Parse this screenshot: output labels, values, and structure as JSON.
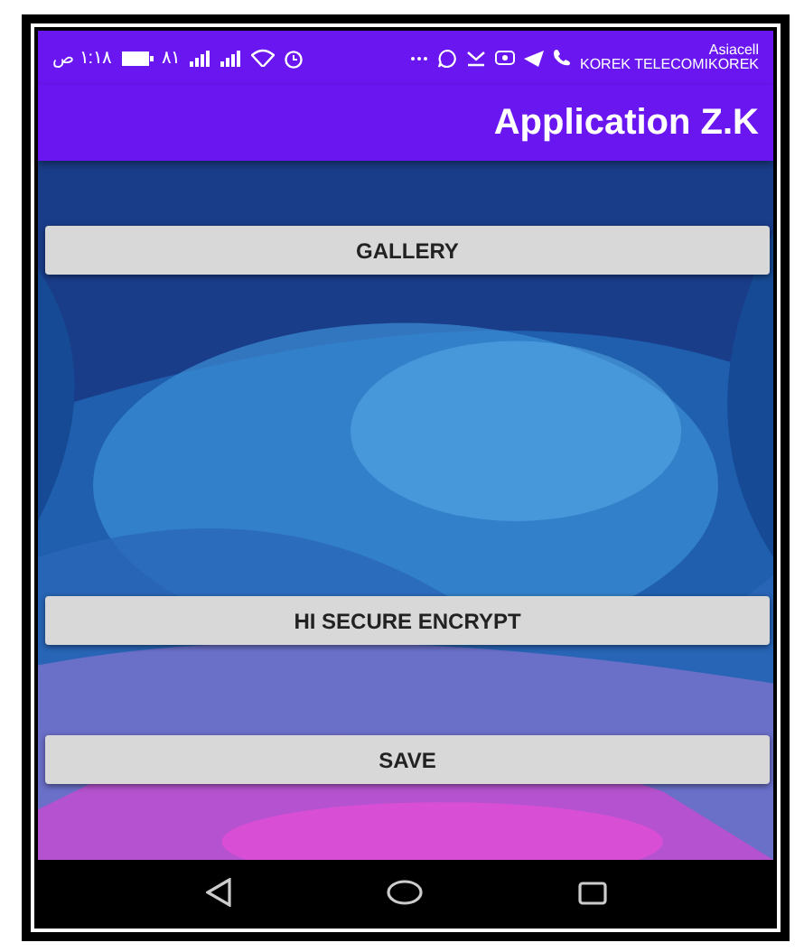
{
  "status_bar": {
    "time": "١:١٨ ص",
    "battery": "٨١",
    "carrier_top": "Asiacell",
    "carrier_bottom": "KOREK TELECOMIKOREK"
  },
  "app_bar": {
    "title": "Application Z.K"
  },
  "buttons": [
    {
      "label": "GALLERY"
    },
    {
      "label": "HI SECURE ENCRYPT"
    },
    {
      "label": "SAVE"
    }
  ]
}
